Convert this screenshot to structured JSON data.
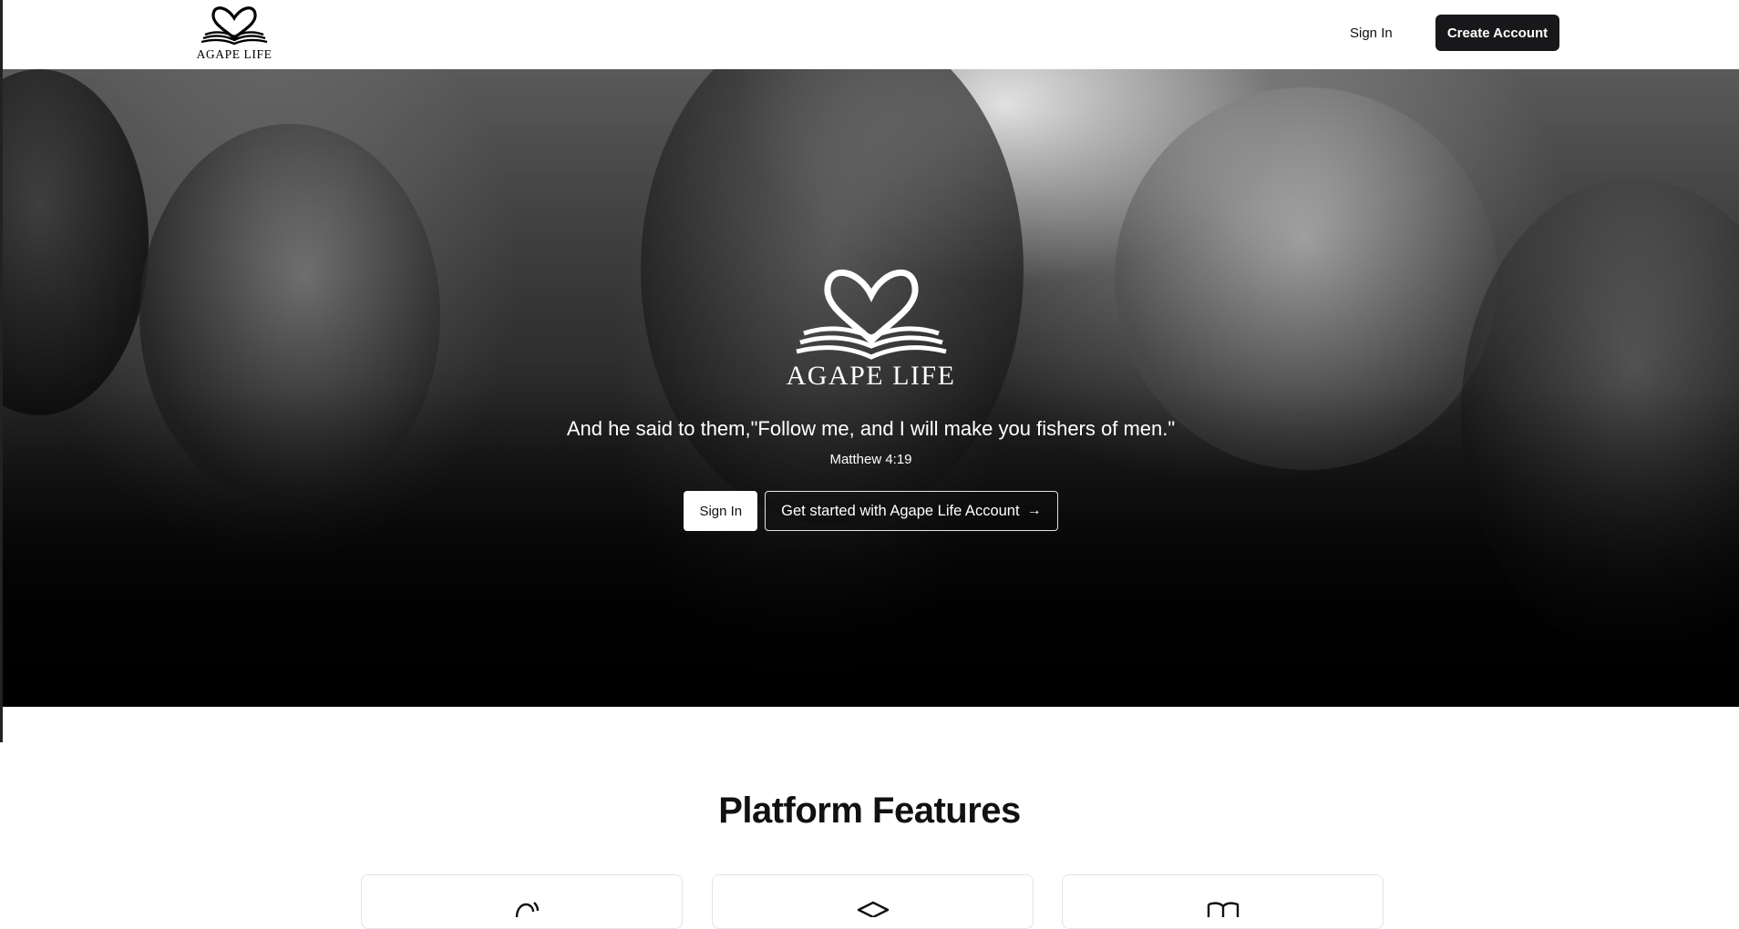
{
  "header": {
    "brand_name": "AGAPE LIFE",
    "signin_label": "Sign In",
    "create_account_label": "Create Account"
  },
  "hero": {
    "brand_name": "AGAPE LIFE",
    "quote": "And he said to them,\"Follow me, and I will make you fishers of men.\"",
    "reference": "Matthew 4:19",
    "signin_label": "Sign In",
    "get_started_label": "Get started with Agape Life Account",
    "get_started_icon": "arrow-right-icon"
  },
  "features": {
    "title": "Platform Features",
    "cards": [
      {
        "icon": "ear-icon"
      },
      {
        "icon": "graduation-cap-icon"
      },
      {
        "icon": "book-open-icon"
      }
    ]
  },
  "colors": {
    "primary_button": "#18181b",
    "hero_text": "#ffffff",
    "card_border": "#e4e4e7"
  }
}
